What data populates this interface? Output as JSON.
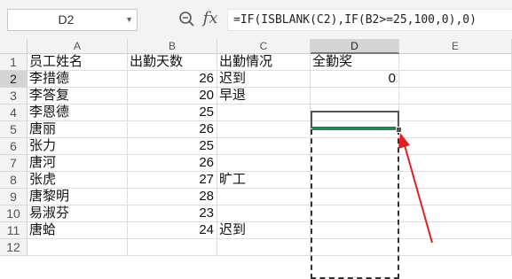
{
  "formula_bar": {
    "name_box": "D2",
    "zoom_icon": "magnifier-icon",
    "fx_icon": "fx-icon",
    "formula": "=IF(ISBLANK(C2),IF(B2>=25,100,0),0)"
  },
  "columns": [
    "A",
    "B",
    "C",
    "D",
    "E"
  ],
  "selected_column": "D",
  "selected_row": "2",
  "rows": [
    {
      "n": "1",
      "A": "员工姓名",
      "B": "出勤天数",
      "C": "出勤情况",
      "D": "全勤奖"
    },
    {
      "n": "2",
      "A": "李措德",
      "B": "26",
      "C": "迟到",
      "D": "0"
    },
    {
      "n": "3",
      "A": "李答复",
      "B": "20",
      "C": "早退",
      "D": ""
    },
    {
      "n": "4",
      "A": "李恩德",
      "B": "25",
      "C": "",
      "D": ""
    },
    {
      "n": "5",
      "A": "唐丽",
      "B": "26",
      "C": "",
      "D": ""
    },
    {
      "n": "6",
      "A": "张力",
      "B": "25",
      "C": "",
      "D": ""
    },
    {
      "n": "7",
      "A": "唐河",
      "B": "26",
      "C": "",
      "D": ""
    },
    {
      "n": "8",
      "A": "张虎",
      "B": "27",
      "C": "旷工",
      "D": ""
    },
    {
      "n": "9",
      "A": "唐黎明",
      "B": "28",
      "C": "",
      "D": ""
    },
    {
      "n": "10",
      "A": "易淑芬",
      "B": "23",
      "C": "",
      "D": ""
    },
    {
      "n": "11",
      "A": "唐蛤",
      "B": "24",
      "C": "迟到",
      "D": ""
    },
    {
      "n": "12",
      "A": "",
      "B": "",
      "C": "",
      "D": ""
    }
  ],
  "colors": {
    "selection_green": "#1e8b52",
    "arrow_red": "#e02020"
  }
}
